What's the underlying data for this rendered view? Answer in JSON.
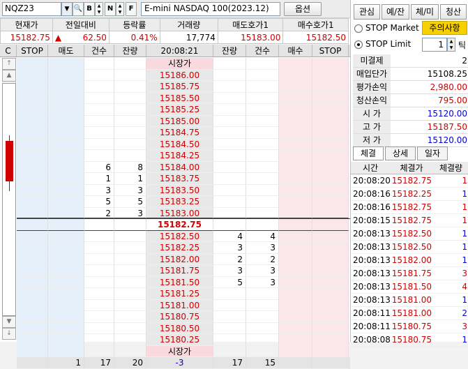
{
  "toolbar": {
    "symbol": "NQZ23",
    "name": "E-mini NASDAQ 100(2023.12)",
    "option_label": "옵션",
    "btn_b": "B",
    "btn_n": "N",
    "btn_f": "F"
  },
  "quote": {
    "headers": [
      "현재가",
      "전일대비",
      "등락률",
      "거래량",
      "매도호가1",
      "매수호가1"
    ],
    "price": "15182.75",
    "change_arrow": "▲",
    "change": "62.50",
    "rate": "0.41%",
    "volume": "17,774",
    "ask1": "15183.00",
    "bid1": "15182.50"
  },
  "orderbook": {
    "headers": [
      "STOP",
      "매도",
      "건수",
      "잔량",
      "20:08:21",
      "잔량",
      "건수",
      "매수",
      "STOP"
    ],
    "top_label": "시장가",
    "ask_rows": [
      {
        "price": "15186.00",
        "cnt": "",
        "qty": ""
      },
      {
        "price": "15185.75",
        "cnt": "",
        "qty": ""
      },
      {
        "price": "15185.50",
        "cnt": "",
        "qty": ""
      },
      {
        "price": "15185.25",
        "cnt": "",
        "qty": ""
      },
      {
        "price": "15185.00",
        "cnt": "",
        "qty": ""
      },
      {
        "price": "15184.75",
        "cnt": "",
        "qty": ""
      },
      {
        "price": "15184.50",
        "cnt": "",
        "qty": ""
      },
      {
        "price": "15184.25",
        "cnt": "",
        "qty": ""
      },
      {
        "price": "15184.00",
        "cnt": "6",
        "qty": "8"
      },
      {
        "price": "15183.75",
        "cnt": "1",
        "qty": "1"
      },
      {
        "price": "15183.50",
        "cnt": "3",
        "qty": "3"
      },
      {
        "price": "15183.25",
        "cnt": "5",
        "qty": "5"
      },
      {
        "price": "15183.00",
        "cnt": "2",
        "qty": "3"
      }
    ],
    "current": "15182.75",
    "bid_rows": [
      {
        "price": "15182.50",
        "qty": "4",
        "cnt": "4"
      },
      {
        "price": "15182.25",
        "qty": "3",
        "cnt": "3"
      },
      {
        "price": "15182.00",
        "qty": "2",
        "cnt": "2"
      },
      {
        "price": "15181.75",
        "qty": "3",
        "cnt": "3"
      },
      {
        "price": "15181.50",
        "qty": "5",
        "cnt": "3"
      },
      {
        "price": "15181.25",
        "qty": "",
        "cnt": ""
      },
      {
        "price": "15181.00",
        "qty": "",
        "cnt": ""
      },
      {
        "price": "15180.75",
        "qty": "",
        "cnt": ""
      },
      {
        "price": "15180.50",
        "qty": "",
        "cnt": ""
      },
      {
        "price": "15180.25",
        "qty": "",
        "cnt": ""
      }
    ],
    "bottom_label": "시장가",
    "footer": {
      "sell": "1",
      "cnt_l": "17",
      "qty_l": "20",
      "diff": "-3",
      "qty_r": "17",
      "cnt_r": "15"
    },
    "side_label": "C"
  },
  "right": {
    "tabs": [
      "관심",
      "예/잔",
      "체/미",
      "청산"
    ],
    "stop_market": "STOP Market",
    "stop_limit": "STOP Limit",
    "warn_btn": "주의사항",
    "tick_value": "1",
    "tick_label": "틱",
    "info": [
      {
        "k": "미결제",
        "v": "2"
      },
      {
        "k": "매입단가",
        "v": "15108.25"
      },
      {
        "k": "평가손익",
        "v": "2,980.00"
      },
      {
        "k": "청산손익",
        "v": "795.00"
      },
      {
        "k": "시 가",
        "v": "15120.00"
      },
      {
        "k": "고 가",
        "v": "15187.50"
      },
      {
        "k": "저 가",
        "v": "15120.00"
      }
    ],
    "trade_tabs": [
      "체결",
      "상세",
      "일자"
    ],
    "trade_headers": [
      "시간",
      "체결가",
      "체결량"
    ],
    "trades": [
      {
        "t": "20:08:20",
        "p": "15182.75",
        "q": "1",
        "side": "buy"
      },
      {
        "t": "20:08:16",
        "p": "15182.25",
        "q": "1",
        "side": "sell"
      },
      {
        "t": "20:08:16",
        "p": "15182.75",
        "q": "1",
        "side": "buy"
      },
      {
        "t": "20:08:15",
        "p": "15182.75",
        "q": "1",
        "side": "buy"
      },
      {
        "t": "20:08:13",
        "p": "15182.50",
        "q": "1",
        "side": "sell"
      },
      {
        "t": "20:08:13",
        "p": "15182.50",
        "q": "1",
        "side": "sell"
      },
      {
        "t": "20:08:13",
        "p": "15182.00",
        "q": "1",
        "side": "sell"
      },
      {
        "t": "20:08:13",
        "p": "15181.75",
        "q": "3",
        "side": "buy"
      },
      {
        "t": "20:08:13",
        "p": "15181.50",
        "q": "4",
        "side": "buy"
      },
      {
        "t": "20:08:13",
        "p": "15181.00",
        "q": "1",
        "side": "sell"
      },
      {
        "t": "20:08:11",
        "p": "15181.00",
        "q": "2",
        "side": "sell"
      },
      {
        "t": "20:08:11",
        "p": "15180.75",
        "q": "3",
        "side": "buy"
      },
      {
        "t": "20:08:08",
        "p": "15180.75",
        "q": "1",
        "side": "sell"
      }
    ]
  },
  "colors": {
    "up": "#d00000",
    "down": "#0000d0",
    "ask_bg": "#e6f0fb",
    "bid_bg": "#fbe6ea"
  }
}
